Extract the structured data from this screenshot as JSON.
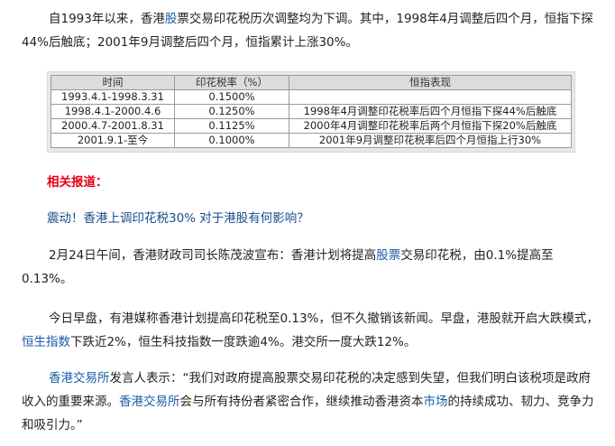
{
  "intro": {
    "a": "自1993年以来，香港",
    "link_gupiao": "股",
    "b": "票交易印花税历次调整均为下调。其中，1998年4月调整后四个月，恒指下探44%后触底；2001年9月调整后四个月，恒指累计上涨30%。"
  },
  "table": {
    "headers": [
      "时间",
      "印花税率（%）",
      "恒指表现"
    ],
    "rows": [
      [
        "1993.4.1-1998.3.31",
        "0.1500%",
        ""
      ],
      [
        "1998.4.1-2000.4.6",
        "0.1250%",
        "1998年4月调整印花税率后四个月恒指下探44%后触底"
      ],
      [
        "2000.4.7-2001.8.31",
        "0.1125%",
        "2000年4月调整印花税率后两个月恒指下探20%后触底"
      ],
      [
        "2001.9.1-至今",
        "0.1000%",
        "2001年9月调整印花税率后四个月恒指上行30%"
      ]
    ]
  },
  "related_label": "相关报道：",
  "headline": "震动！香港上调印花税30% 对于港股有何影响？",
  "para2": {
    "a": "2月24日午间，香港财政司司长陈茂波宣布：香港计划将提高",
    "link_gupiao": "股票",
    "b": "交易印花税，由0.1%提高至0.13%。"
  },
  "para3": {
    "a": "今日早盘，有港媒称香港计划提高印花税至0.13%，但不久撤销该新闻。早盘，港股就开启大跌模式，",
    "link_hsi": "恒生指数",
    "b": "下跌近2%，恒生科技指数一度跌逾4%。港交所一度大跌12%。"
  },
  "para4": {
    "link_hkex1": "香港交易所",
    "a": "发言人表示：“我们对政府提高股票交易印花税的决定感到失望，但我们明白该税项是政府收入的重要来源。",
    "link_hkex2": "香港交易所",
    "b": "会与所有持份者紧密合作，继续推动香港资本",
    "link_market": "市场",
    "c": "的持续成功、韧力、竞争力和吸引力。”"
  },
  "colors": {
    "accent_red": "#e60012",
    "link_blue": "#1a5ca8",
    "headline_blue": "#1a4b8c"
  }
}
